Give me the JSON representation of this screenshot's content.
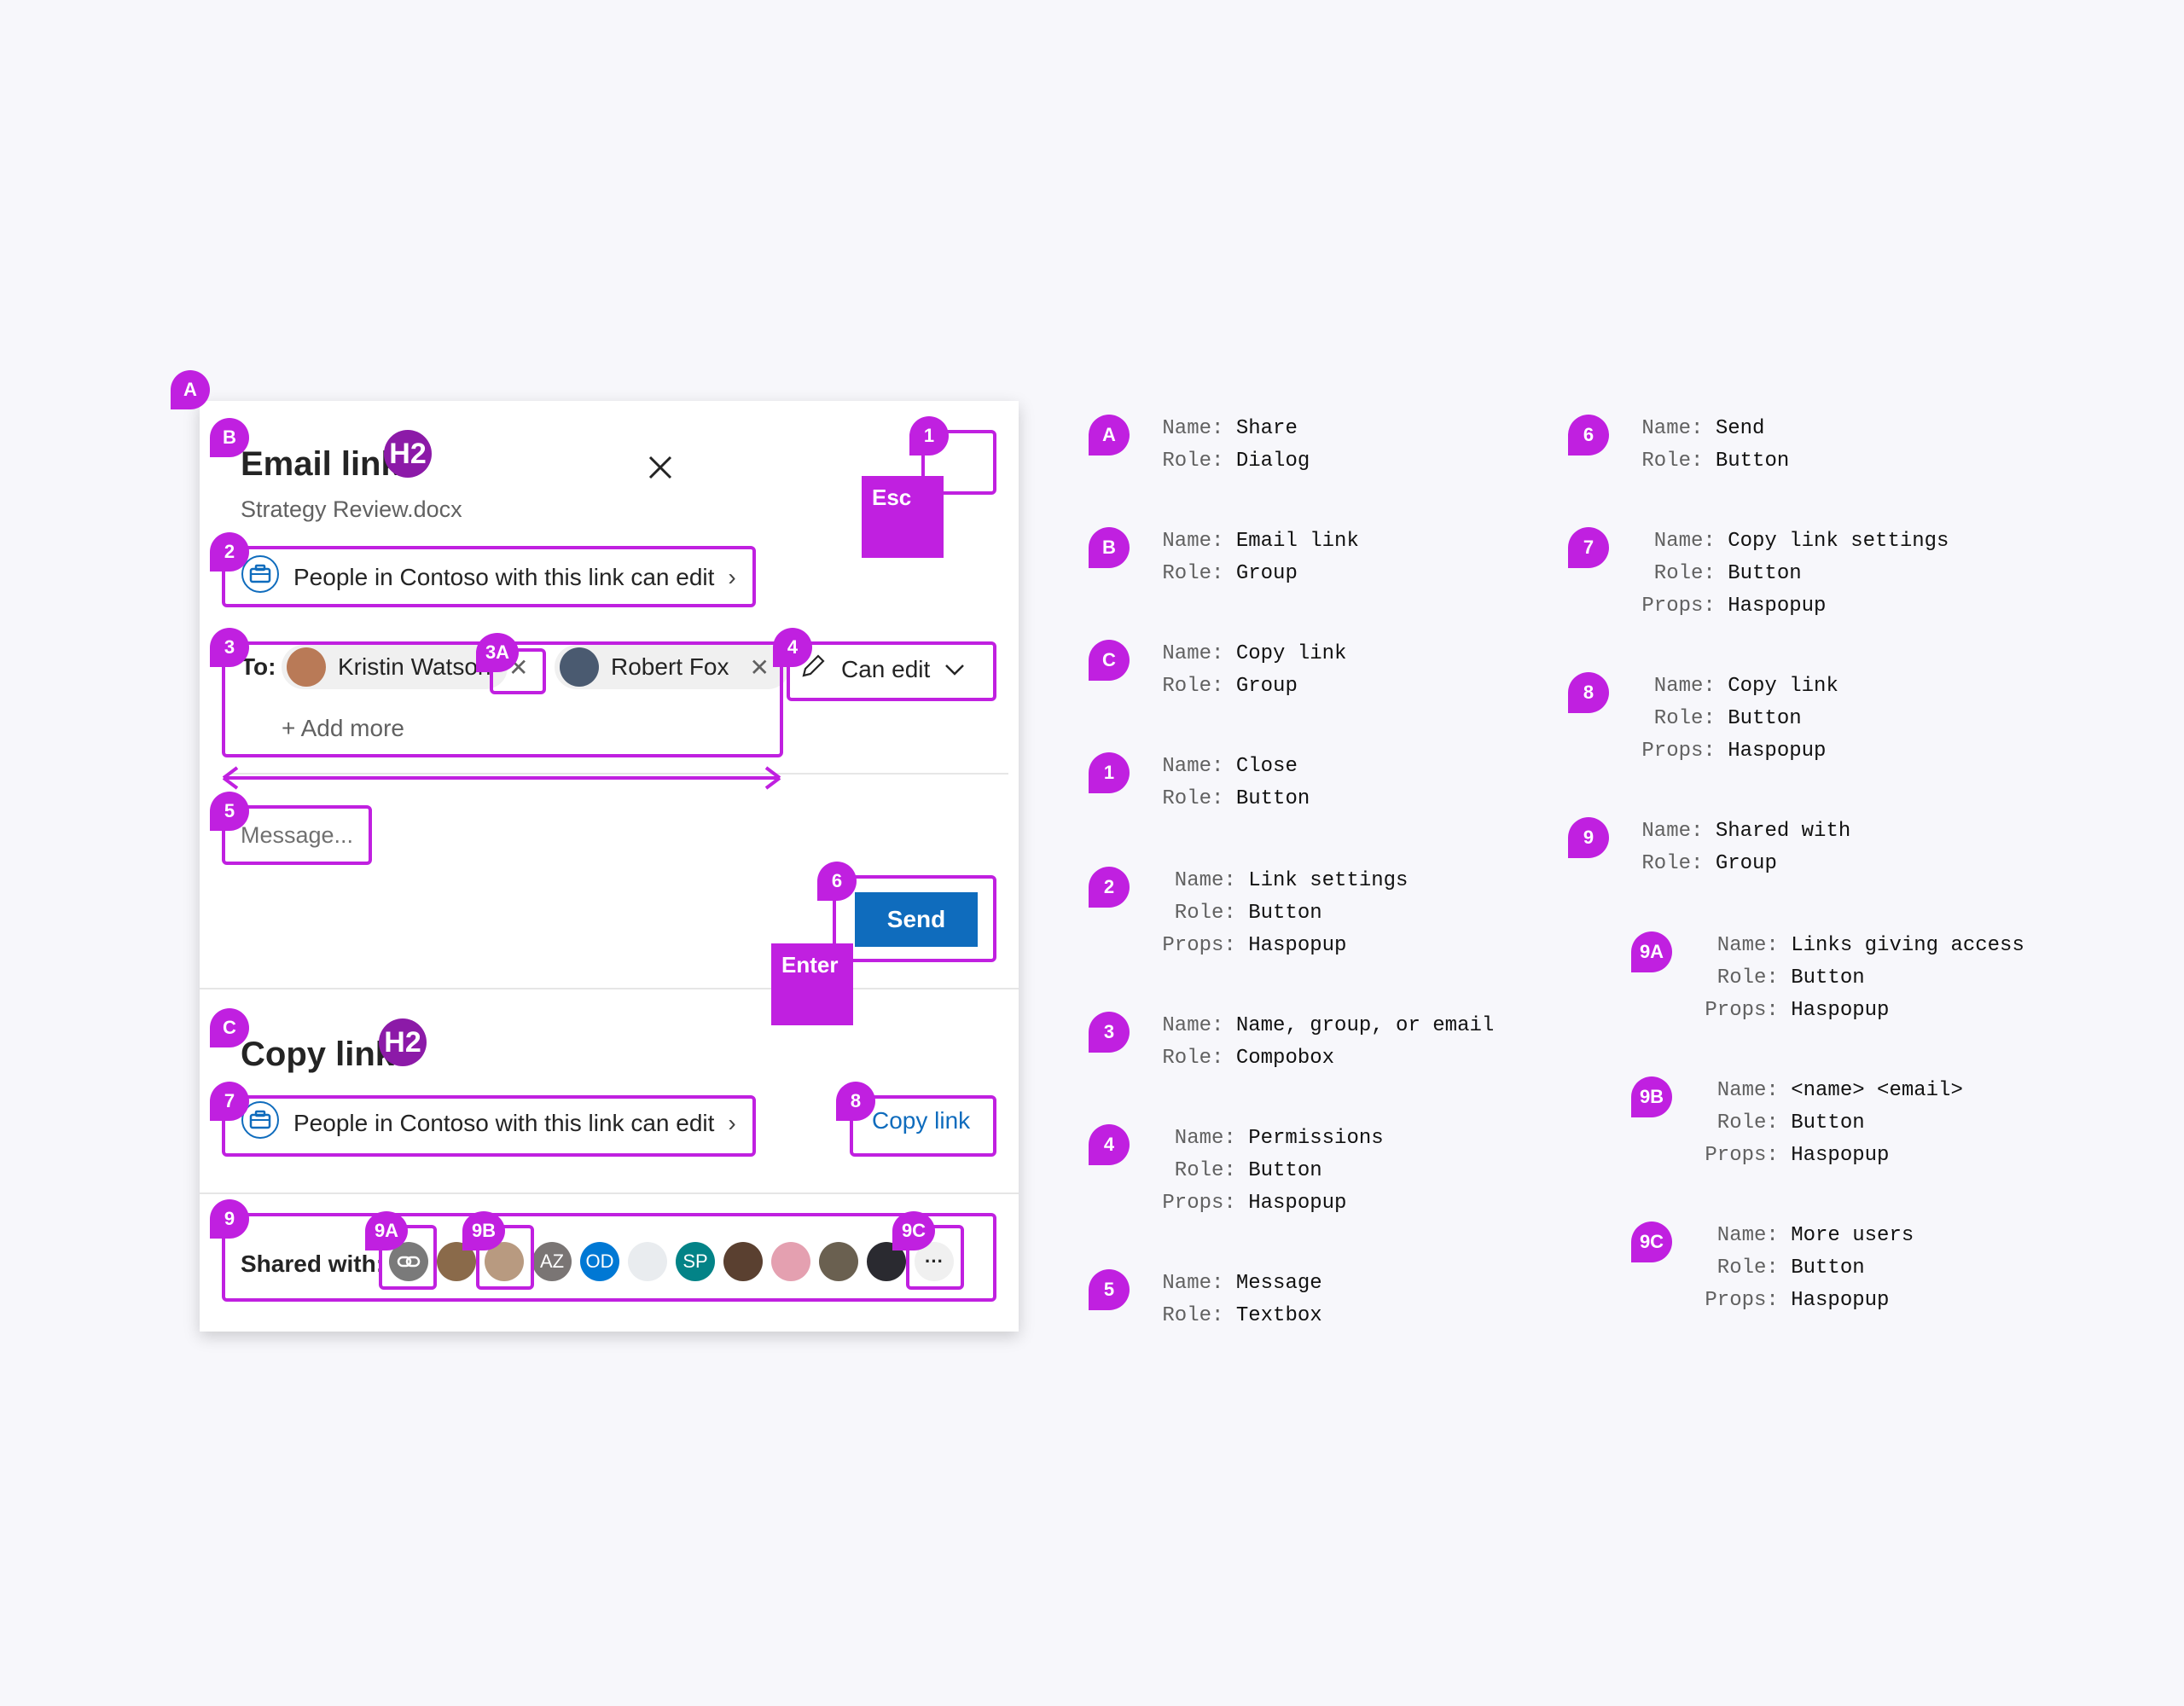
{
  "dialog": {
    "email_title": "Email link",
    "file_name": "Strategy Review.docx",
    "link_setting_label": "People in Contoso with this link can edit",
    "to_label": "To:",
    "recipients": [
      "Kristin Watson",
      "Robert Fox"
    ],
    "add_more": "+ Add more",
    "permission": "Can edit",
    "message_placeholder": "Message...",
    "send": "Send",
    "copy_title": "Copy link",
    "copy_link_setting_label": "People in Contoso with this link can edit",
    "copy_link_button": "Copy link",
    "shared_with_label": "Shared with:",
    "shared_avatars": [
      "AZ",
      "OD",
      "SP"
    ],
    "more": "···"
  },
  "annotations": {
    "heading_badge": "H2",
    "esc_key": "Esc",
    "enter_key": "Enter",
    "badges": [
      "A",
      "B",
      "C",
      "1",
      "2",
      "3",
      "3A",
      "4",
      "5",
      "6",
      "7",
      "8",
      "9",
      "9A",
      "9B",
      "9C"
    ]
  },
  "legend": {
    "name_key": "Name:",
    "role_key": "Role:",
    "props_key": "Props:",
    "items": [
      {
        "id": "A",
        "name": "Share",
        "role": "Dialog"
      },
      {
        "id": "B",
        "name": "Email link",
        "role": "Group"
      },
      {
        "id": "C",
        "name": "Copy link",
        "role": "Group"
      },
      {
        "id": "1",
        "name": "Close",
        "role": "Button"
      },
      {
        "id": "2",
        "name": "Link settings",
        "role": "Button",
        "props": "Haspopup"
      },
      {
        "id": "3",
        "name": "Name, group, or email",
        "role": "Compobox"
      },
      {
        "id": "4",
        "name": "Permissions",
        "role": "Button",
        "props": "Haspopup"
      },
      {
        "id": "5",
        "name": "Message",
        "role": "Textbox"
      },
      {
        "id": "6",
        "name": "Send",
        "role": "Button"
      },
      {
        "id": "7",
        "name": "Copy link settings",
        "role": "Button",
        "props": "Haspopup"
      },
      {
        "id": "8",
        "name": "Copy link",
        "role": "Button",
        "props": "Haspopup"
      },
      {
        "id": "9",
        "name": "Shared with",
        "role": "Group"
      },
      {
        "id": "9A",
        "name": "Links giving access",
        "role": "Button",
        "props": "Haspopup"
      },
      {
        "id": "9B",
        "name": "<name> <email>",
        "role": "Button",
        "props": "Haspopup"
      },
      {
        "id": "9C",
        "name": "More users",
        "role": "Button",
        "props": "Haspopup"
      }
    ]
  },
  "colors": {
    "accent": "#c020e0",
    "send_blue": "#0f6cbd",
    "link_blue": "#0f6cbd",
    "h2": "#8c1aa8"
  }
}
